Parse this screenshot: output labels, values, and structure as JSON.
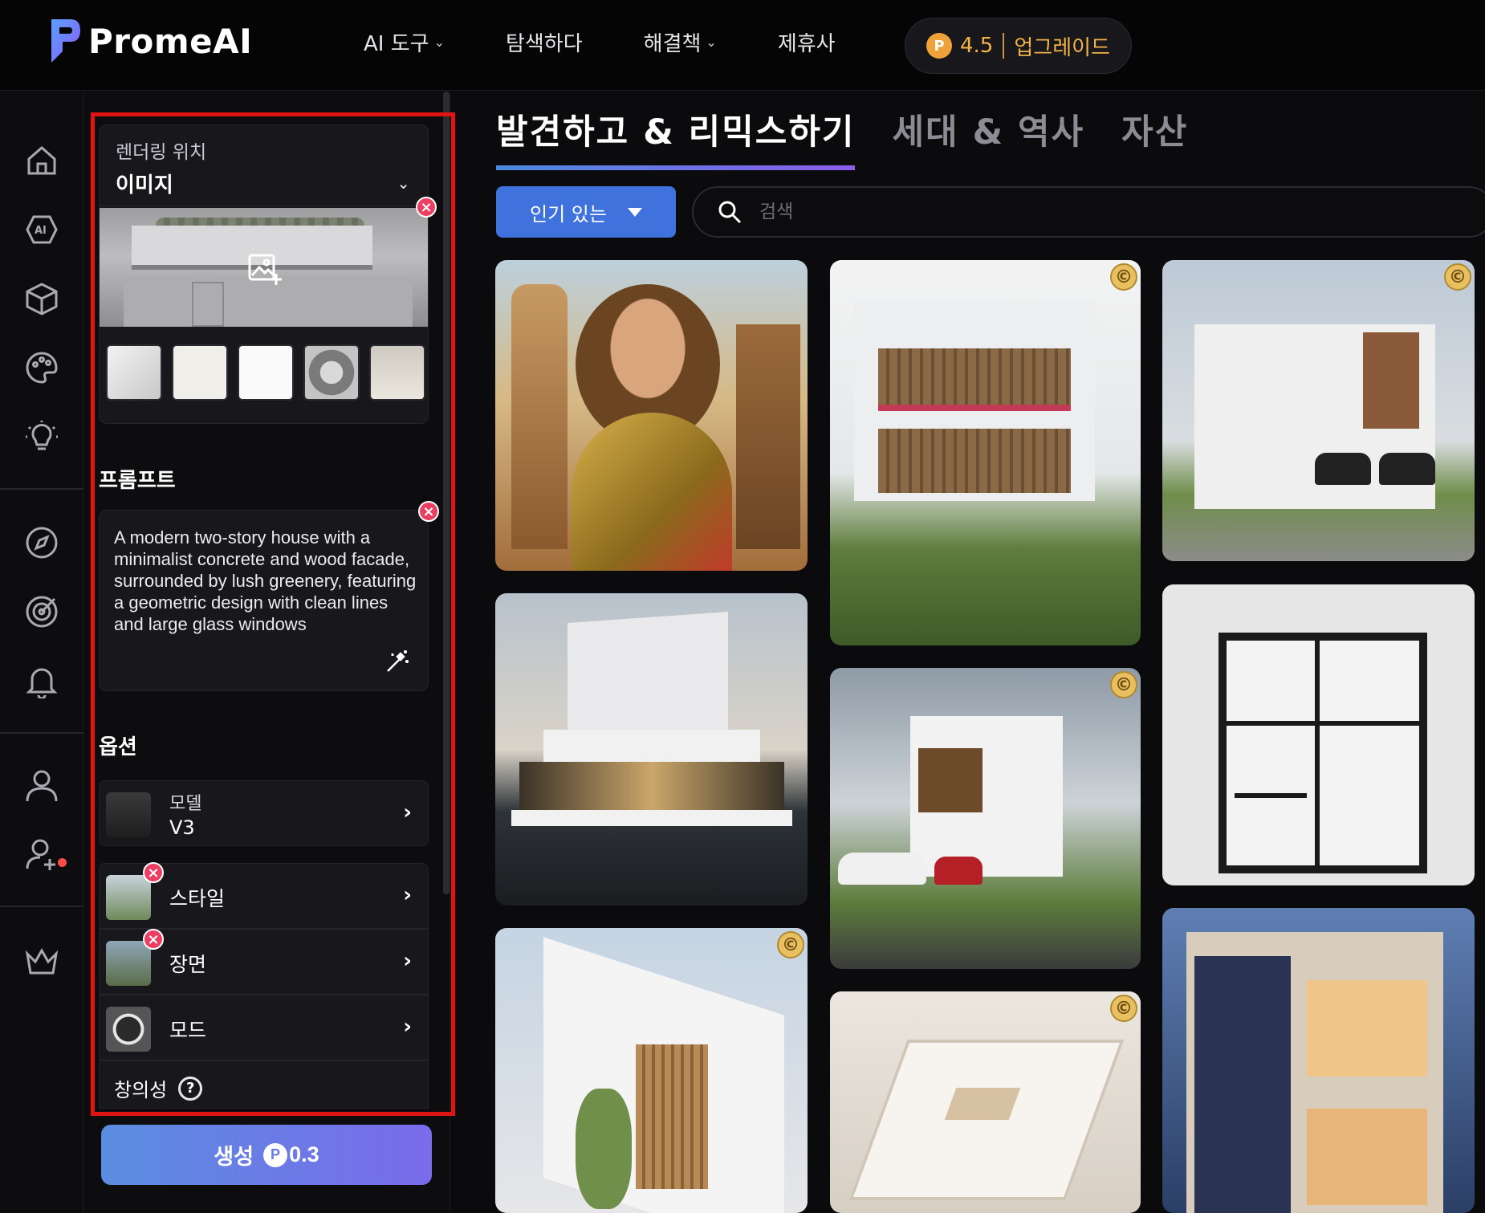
{
  "header": {
    "logo_text": "PromeAI",
    "nav": [
      {
        "label": "AI 도구",
        "has_dropdown": true
      },
      {
        "label": "탐색하다",
        "has_dropdown": false
      },
      {
        "label": "해결책",
        "has_dropdown": true
      },
      {
        "label": "제휴사",
        "has_dropdown": false
      }
    ],
    "credits": "4.5",
    "upgrade_label": "업그레이드"
  },
  "rail": {
    "icons": [
      "home-icon",
      "ai-icon",
      "cube-icon",
      "palette-icon",
      "lightbulb-icon",
      "compass-icon",
      "target-icon",
      "bell-icon",
      "user-icon",
      "user-add-icon",
      "crown-icon"
    ]
  },
  "panel": {
    "render_label": "렌더링 위치",
    "render_value": "이미지",
    "prompt_title": "프롬프트",
    "prompt_text": "A modern two-story house with a minimalist concrete and wood facade, surrounded by lush greenery, featuring a geometric design with clean lines and large glass windows",
    "options_title": "옵션",
    "model_label": "모델",
    "model_value": "V3",
    "style_label": "스타일",
    "scene_label": "장면",
    "mode_label": "모드",
    "creativity_label": "창의성",
    "generate_label": "생성",
    "generate_cost": "0.3"
  },
  "main": {
    "tabs": [
      "발견하고 & 리믹스하기",
      "세대 & 역사",
      "자산"
    ],
    "sort_label": "인기 있는",
    "search_placeholder": "검색"
  },
  "colors": {
    "accent_blue": "#3f72dd",
    "upgrade_gold": "#f3b347",
    "highlight_red": "#e11414",
    "close_pink": "#ec3d62"
  }
}
